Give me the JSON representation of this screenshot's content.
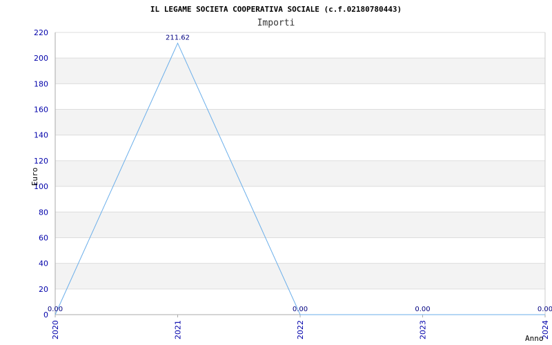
{
  "chart_data": {
    "type": "line",
    "title": "IL LEGAME SOCIETA COOPERATIVA SOCIALE (c.f.02180780443)",
    "subtitle": "Importi",
    "xlabel": "Anno",
    "ylabel": "Euro",
    "x": [
      "2020",
      "2021",
      "2022",
      "2023",
      "2024"
    ],
    "series": [
      {
        "values": [
          0.0,
          211.62,
          0.0,
          0.0,
          0.0
        ]
      }
    ],
    "data_labels": [
      "0.00",
      "211.62",
      "0.00",
      "0.00",
      "0.00"
    ],
    "ylim": [
      0,
      220
    ],
    "yticks": [
      0,
      20,
      40,
      60,
      80,
      100,
      120,
      140,
      160,
      180,
      200,
      220
    ],
    "grid": true,
    "line_color": "#6aaeea",
    "band_color": "#f3f3f3"
  }
}
